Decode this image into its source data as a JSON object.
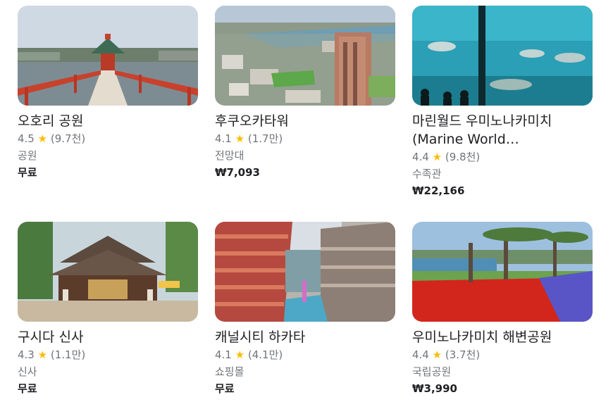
{
  "cards": [
    {
      "title": "오호리 공원",
      "rating": "4.5",
      "star": "★",
      "reviews": "(9.7천)",
      "category": "공원",
      "price": "무료",
      "image": "pond-bridge-gazebo"
    },
    {
      "title": "후쿠오카타워",
      "rating": "4.1",
      "star": "★",
      "reviews": "(1.7만)",
      "category": "전망대",
      "price": "₩7,093",
      "image": "city-tower-aerial"
    },
    {
      "title": "마린월드 우미노나카미치\n(Marine World…",
      "rating": "4.4",
      "star": "★",
      "reviews": "(9.8천)",
      "category": "수족관",
      "price": "₩22,166",
      "image": "aquarium-tank"
    },
    {
      "title": "구시다 신사",
      "rating": "4.3",
      "star": "★",
      "reviews": "(1.1만)",
      "category": "신사",
      "price": "무료",
      "image": "shrine-building"
    },
    {
      "title": "캐널시티 하카타",
      "rating": "4.1",
      "star": "★",
      "reviews": "(4.1만)",
      "category": "쇼핑몰",
      "price": "무료",
      "image": "mall-canal"
    },
    {
      "title": "우미노나카미치 해변공원",
      "rating": "4.4",
      "star": "★",
      "reviews": "(3.7천)",
      "category": "국립공원",
      "price": "₩3,990",
      "image": "tulip-garden"
    }
  ]
}
